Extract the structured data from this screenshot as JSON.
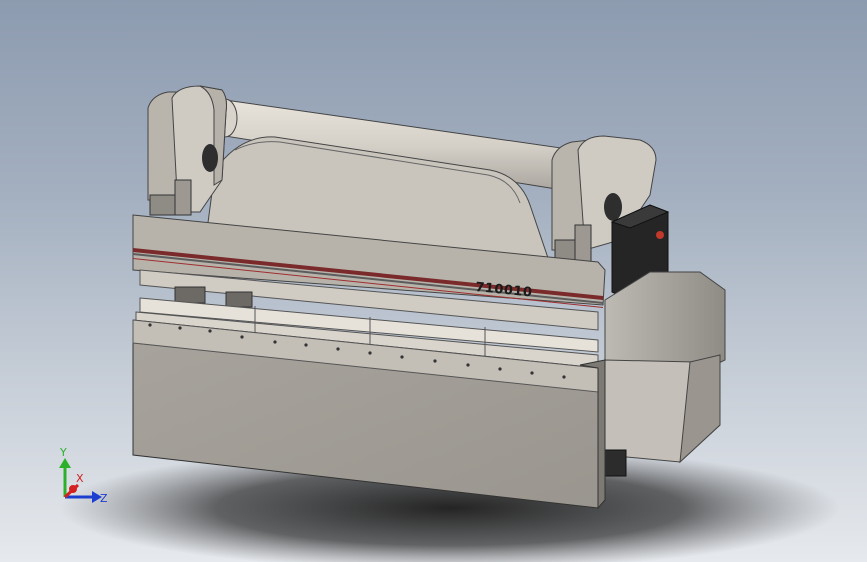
{
  "viewport": {
    "background_top": "#8d9bb0",
    "background_bottom": "#e6e9ed"
  },
  "model": {
    "label": "710010",
    "body_color": "#a39f98",
    "stripe_color": "#7a2a2a",
    "panel_color": "#1e1e1e"
  },
  "triad": {
    "x_label": "X",
    "y_label": "Y",
    "z_label": "Z",
    "x_color": "#d42020",
    "y_color": "#2cb02c",
    "z_color": "#1c3ed0"
  }
}
